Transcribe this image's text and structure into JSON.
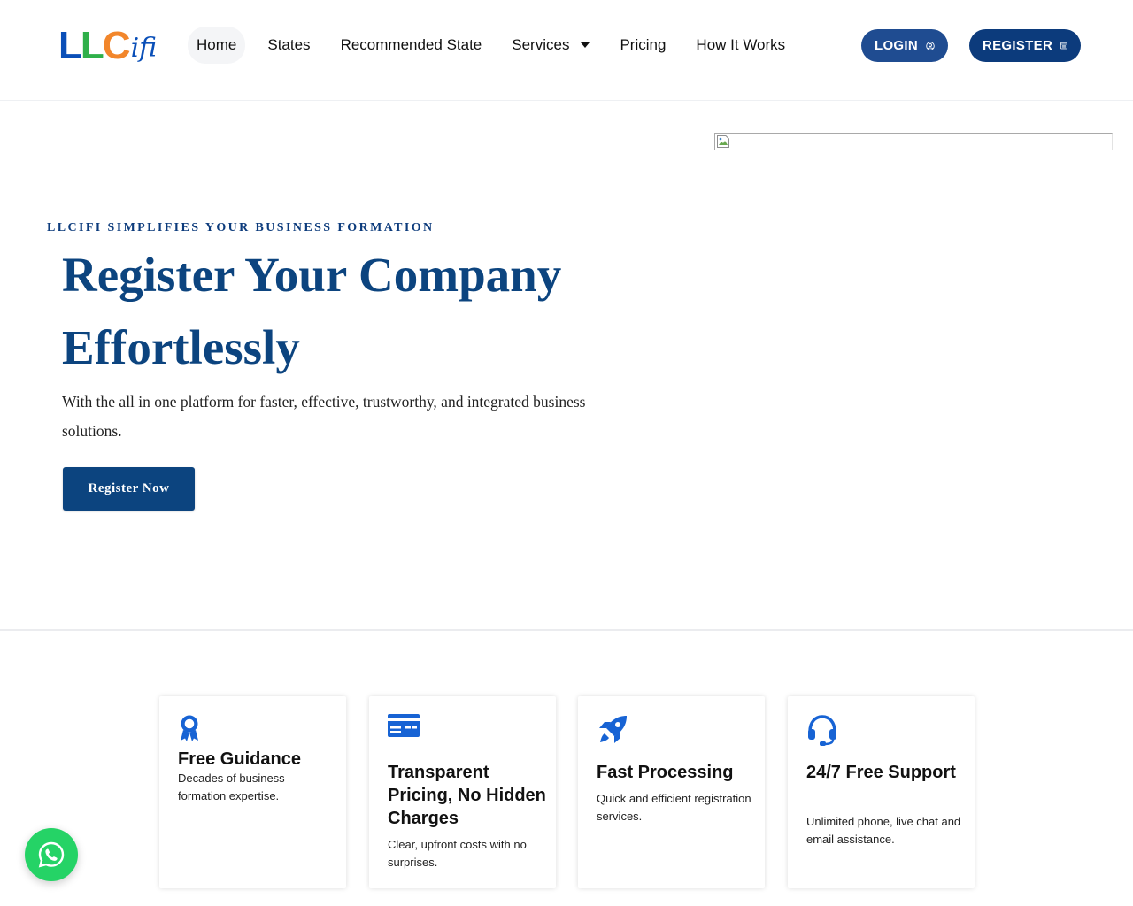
{
  "brand": {
    "logo_parts": [
      "L",
      "L",
      "C",
      "ifi"
    ],
    "colors": {
      "blue": "#0a4fb8",
      "green": "#2fb04a",
      "orange": "#f2862b"
    }
  },
  "nav": {
    "items": [
      {
        "label": "Home",
        "active": true
      },
      {
        "label": "States"
      },
      {
        "label": "Recommended State"
      },
      {
        "label": "Services",
        "has_dropdown": true
      },
      {
        "label": "Pricing"
      },
      {
        "label": "How It Works"
      }
    ]
  },
  "header_actions": {
    "login_label": "LOGIN",
    "login_icon": "user-circle-icon",
    "register_label": "REGISTER",
    "register_icon": "calendar-icon"
  },
  "hero": {
    "eyebrow": "LLCIFI SIMPLIFIES YOUR BUSINESS FORMATION",
    "title": "Register Your Company Effortlessly",
    "subtitle": "With the all in one platform for faster, effective, trustworthy, and integrated business solutions.",
    "cta_label": "Register Now",
    "image_icon": "broken-image-icon"
  },
  "features": [
    {
      "icon": "award-ribbon-icon",
      "title": "Free Guidance",
      "description": "Decades of business formation expertise."
    },
    {
      "icon": "credit-card-icon",
      "title": "Transparent Pricing, No Hidden Charges",
      "description": "Clear, upfront costs with no surprises."
    },
    {
      "icon": "rocket-icon",
      "title": "Fast Processing",
      "description": "Quick and efficient registration services."
    },
    {
      "icon": "headset-icon",
      "title": "24/7 Free Support",
      "description": "Unlimited phone, live chat and email assistance."
    }
  ],
  "chat_widget": {
    "icon": "whatsapp-icon"
  },
  "theme": {
    "primary": "#0c447f",
    "accent": "#0c3b7c",
    "icon_blue": "#1763d4",
    "whatsapp_green": "#25d366"
  }
}
